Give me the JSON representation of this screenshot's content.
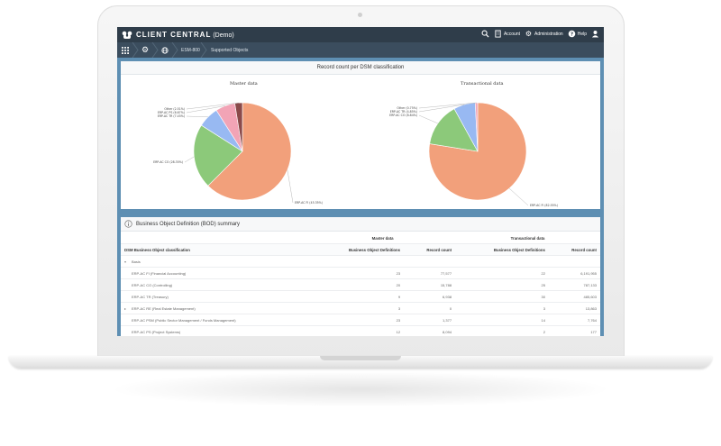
{
  "header": {
    "brand": "CLIENT CENTRAL",
    "brand_suffix": "(Demo)",
    "account": "Account",
    "administration": "Administration",
    "help": "Help"
  },
  "breadcrumb": {
    "item1": "ESM-800",
    "item2": "Supported Objects"
  },
  "record_panel": {
    "title": "Record count per DSM classification"
  },
  "chart_data": [
    {
      "type": "pie",
      "title": "Master data",
      "labels": [
        "ERP-AC FI (45.35%)",
        "ERP-AC CO (28.35%)",
        "ERP-AC TR (7.45%)",
        "ERP-AC PS (6.67%)",
        "Other (2.51%)"
      ],
      "values": [
        62.5,
        21.5,
        7.0,
        6.5,
        2.5
      ],
      "colors": [
        "#f2a07b",
        "#8cc97a",
        "#98b9f2",
        "#f2a4b6",
        "#8a4a4a"
      ]
    },
    {
      "type": "pie",
      "title": "Transactional data",
      "labels": [
        "ERP-AC FI (82.55%)",
        "ERP-AC CO (8.84%)",
        "ERP-AC TR (4.85%)",
        "Other (0.75%)"
      ],
      "values": [
        77.5,
        14.5,
        7.2,
        0.8
      ],
      "colors": [
        "#f2a07b",
        "#8cc97a",
        "#98b9f2",
        "#f2a4b6"
      ]
    }
  ],
  "bod_panel": {
    "title": "Business Object Definition (BOD) summary",
    "group_master": "Master data",
    "group_transactional": "Transactional data",
    "col_classification": "DSM Business Object classification",
    "col_bod": "Business Object Definitions",
    "col_count": "Record count",
    "rows": [
      {
        "name": "Basis",
        "m_bod": "",
        "m_cnt": "",
        "t_bod": "",
        "t_cnt": "",
        "toggle": "▾"
      },
      {
        "name": "ERP-AC FI (Financial Accounting)",
        "m_bod": "23",
        "m_cnt": "77,577",
        "t_bod": "22",
        "t_cnt": "6,191,955",
        "toggle": ""
      },
      {
        "name": "ERP-AC CO (Controlling)",
        "m_bod": "20",
        "m_cnt": "15,788",
        "t_bod": "25",
        "t_cnt": "787,133",
        "toggle": ""
      },
      {
        "name": "ERP-AC TR (Treasury)",
        "m_bod": "9",
        "m_cnt": "6,938",
        "t_bod": "30",
        "t_cnt": "485,603",
        "toggle": ""
      },
      {
        "name": "ERP-AC RE (Real Estate Management)",
        "m_bod": "3",
        "m_cnt": "0",
        "t_bod": "3",
        "t_cnt": "13,863",
        "toggle": "▸"
      },
      {
        "name": "ERP-AC PSM (Public Sector Management / Funds Management)",
        "m_bod": "23",
        "m_cnt": "1,377",
        "t_bod": "14",
        "t_cnt": "7,764",
        "toggle": ""
      },
      {
        "name": "ERP-AC PS (Project Systems)",
        "m_bod": "12",
        "m_cnt": "8,094",
        "t_bod": "2",
        "t_cnt": "177",
        "toggle": ""
      }
    ]
  }
}
